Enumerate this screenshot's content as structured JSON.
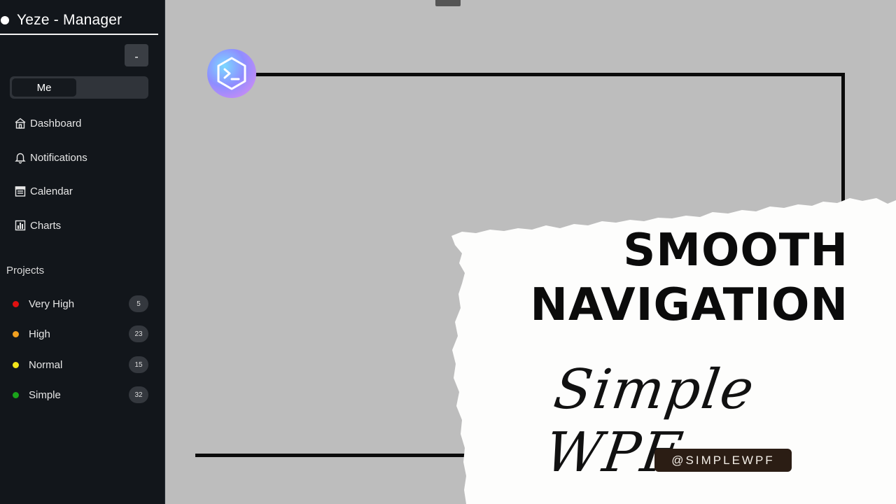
{
  "app": {
    "title": "Yeze - Manager",
    "minimize_label": "-"
  },
  "toggle": {
    "selected_label": "Me"
  },
  "nav": [
    {
      "label": "Dashboard",
      "icon": "home-icon"
    },
    {
      "label": "Notifications",
      "icon": "bell-icon"
    },
    {
      "label": "Calendar",
      "icon": "calendar-icon"
    },
    {
      "label": "Charts",
      "icon": "bar-chart-icon"
    }
  ],
  "projects": {
    "heading": "Projects",
    "items": [
      {
        "label": "Very High",
        "count": "5",
        "color": "#e01010"
      },
      {
        "label": "High",
        "count": "23",
        "color": "#f0a020"
      },
      {
        "label": "Normal",
        "count": "15",
        "color": "#f2e51a"
      },
      {
        "label": "Simple",
        "count": "32",
        "color": "#1aa31a"
      }
    ]
  },
  "banner": {
    "headline_1": "SMOOTH",
    "headline_2": "NAVIGATION",
    "script": "Simple WPF",
    "handle": "@SIMPLEWPF"
  },
  "colors": {
    "sidebar_bg": "#12161b",
    "main_bg": "#bdbdbd",
    "handle_bg": "#2b1d14"
  }
}
